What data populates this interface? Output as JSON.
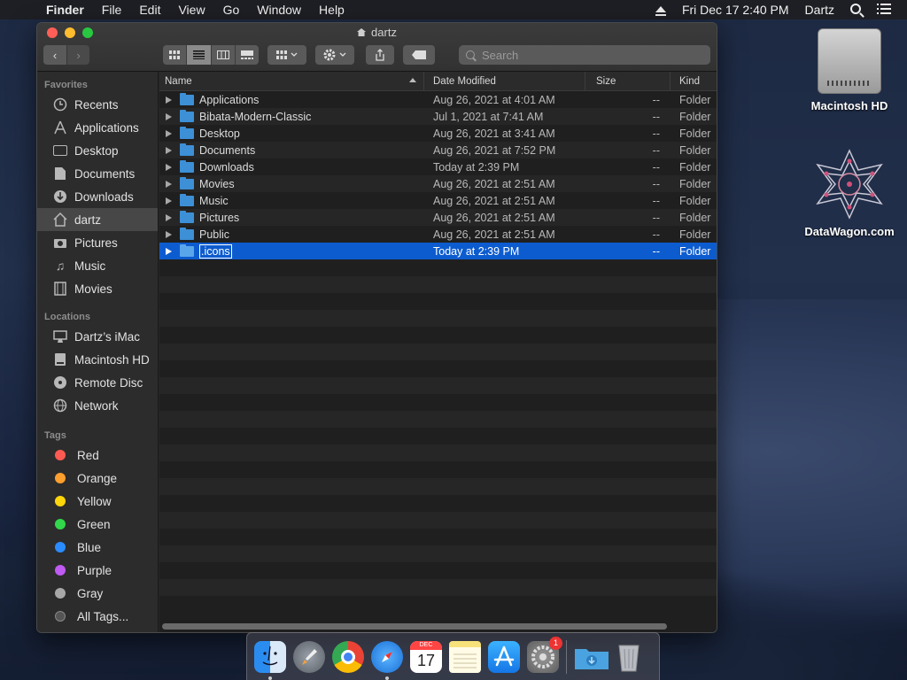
{
  "menubar": {
    "apple": "",
    "items": [
      "Finder",
      "File",
      "Edit",
      "View",
      "Go",
      "Window",
      "Help"
    ],
    "datetime": "Fri Dec 17  2:40 PM",
    "user": "Dartz"
  },
  "window": {
    "title": "dartz",
    "search_placeholder": "Search"
  },
  "sidebar": {
    "favorites_header": "Favorites",
    "favorites": [
      {
        "label": "Recents",
        "icon": "clock-icon"
      },
      {
        "label": "Applications",
        "icon": "applications-icon"
      },
      {
        "label": "Desktop",
        "icon": "desktop-icon"
      },
      {
        "label": "Documents",
        "icon": "document-icon"
      },
      {
        "label": "Downloads",
        "icon": "download-icon"
      },
      {
        "label": "dartz",
        "icon": "home-icon"
      },
      {
        "label": "Pictures",
        "icon": "camera-icon"
      },
      {
        "label": "Music",
        "icon": "music-note-icon"
      },
      {
        "label": "Movies",
        "icon": "film-icon"
      }
    ],
    "locations_header": "Locations",
    "locations": [
      {
        "label": "Dartz’s iMac",
        "icon": "imac-icon"
      },
      {
        "label": "Macintosh HD",
        "icon": "hard-drive-icon"
      },
      {
        "label": "Remote Disc",
        "icon": "disc-icon"
      },
      {
        "label": "Network",
        "icon": "globe-icon"
      }
    ],
    "tags_header": "Tags",
    "tags": [
      {
        "label": "Red",
        "color": "#ff5a52"
      },
      {
        "label": "Orange",
        "color": "#ff9f2e"
      },
      {
        "label": "Yellow",
        "color": "#ffd60a"
      },
      {
        "label": "Green",
        "color": "#32d74b"
      },
      {
        "label": "Blue",
        "color": "#2a8cff"
      },
      {
        "label": "Purple",
        "color": "#bf5af2"
      },
      {
        "label": "Gray",
        "color": "#a8a8a8"
      },
      {
        "label": "All Tags...",
        "color": "#555555"
      }
    ]
  },
  "columns": {
    "name": "Name",
    "date": "Date Modified",
    "size": "Size",
    "kind": "Kind"
  },
  "files": [
    {
      "name": "Applications",
      "date": "Aug 26, 2021 at 4:01 AM",
      "size": "--",
      "kind": "Folder"
    },
    {
      "name": "Bibata-Modern-Classic",
      "date": "Jul 1, 2021 at 7:41 AM",
      "size": "--",
      "kind": "Folder"
    },
    {
      "name": "Desktop",
      "date": "Aug 26, 2021 at 3:41 AM",
      "size": "--",
      "kind": "Folder"
    },
    {
      "name": "Documents",
      "date": "Aug 26, 2021 at 7:52 PM",
      "size": "--",
      "kind": "Folder"
    },
    {
      "name": "Downloads",
      "date": "Today at 2:39 PM",
      "size": "--",
      "kind": "Folder"
    },
    {
      "name": "Movies",
      "date": "Aug 26, 2021 at 2:51 AM",
      "size": "--",
      "kind": "Folder"
    },
    {
      "name": "Music",
      "date": "Aug 26, 2021 at 2:51 AM",
      "size": "--",
      "kind": "Folder"
    },
    {
      "name": "Pictures",
      "date": "Aug 26, 2021 at 2:51 AM",
      "size": "--",
      "kind": "Folder"
    },
    {
      "name": "Public",
      "date": "Aug 26, 2021 at 2:51 AM",
      "size": "--",
      "kind": "Folder"
    },
    {
      "name": ".icons",
      "date": "Today at 2:39 PM",
      "size": "--",
      "kind": "Folder"
    }
  ],
  "desktop": {
    "hd_label": "Macintosh HD",
    "dw_label": "DataWagon.com"
  },
  "dock": {
    "settings_badge": "1",
    "calendar_month": "DEC",
    "calendar_day": "17"
  }
}
